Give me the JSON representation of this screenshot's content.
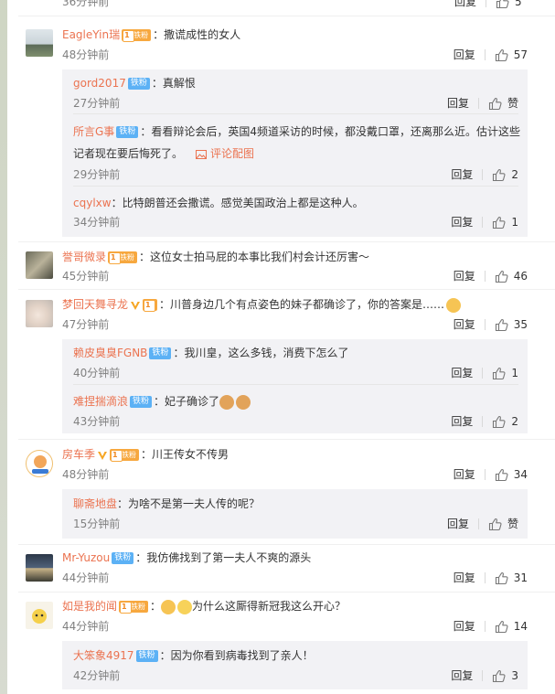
{
  "top_partial": {
    "reply": "回复",
    "likes": "5",
    "time": "36分钟前"
  },
  "labels": {
    "reply": "回复",
    "like_zan": "赞",
    "pic_comment": "评论配图"
  },
  "badges": {
    "tie": "铁粉",
    "fan": "铁粉",
    "fan_level": "1"
  },
  "colors": {
    "username": "#eb7350",
    "time": "#808080",
    "badge_blue": "#5cb1f5",
    "badge_orange": "#f7a83f",
    "reply_bg": "#f2f2f5"
  },
  "comments": [
    {
      "user": "EagleYin瑞",
      "text": "：撒谎成性的女人",
      "time": "48分钟前",
      "likes": "57"
    },
    {
      "user": "誉哥微录",
      "text": "：这位女士拍马屁的本事比我们村会计还厉害～",
      "time": "45分钟前",
      "likes": "46"
    },
    {
      "user": "梦回天舞寻龙",
      "text": "：川普身边几个有点姿色的妹子都确诊了，你的答案是……",
      "time": "47分钟前",
      "likes": "35"
    },
    {
      "user": "房车季",
      "text": "：川王传女不传男",
      "time": "48分钟前",
      "likes": "34"
    },
    {
      "user": "Mr-Yuzou",
      "text": "：我仿佛找到了第一夫人不爽的源头",
      "time": "44分钟前",
      "likes": "31"
    },
    {
      "user": "如是我的闻",
      "text": "为什么这厮得新冠我这么开心？",
      "time": "44分钟前",
      "likes": "14"
    }
  ],
  "replies": {
    "c1": [
      {
        "user": "gord2017",
        "text": "：真解恨",
        "time": "27分钟前",
        "likes": "赞"
      },
      {
        "user": "所言G事",
        "text": "：看看辩论会后，英国4频道采访的时候，都没戴口罩，还离那么近。估计这些",
        "text2": "记者现在要后悔死了。",
        "time": "29分钟前",
        "likes": "2"
      },
      {
        "user": "cqylxw",
        "text": "：比特朗普还会撒谎。感觉美国政治上都是这种人。",
        "time": "34分钟前",
        "likes": "1"
      }
    ],
    "c3": [
      {
        "user": "赖皮臭臭FGNB",
        "text": "：我川皇，这么多钱，消费下怎么了",
        "time": "40分钟前",
        "likes": "1"
      },
      {
        "user": "难捏揣滴浪",
        "text": "：妃子确诊了",
        "time": "43分钟前",
        "likes": "2"
      }
    ],
    "c4": [
      {
        "user": "聊斋地盘",
        "text": "：为啥不是第一夫人传的呢？",
        "time": "15分钟前",
        "likes": "赞"
      }
    ],
    "c6": [
      {
        "user": "大笨象4917",
        "text": "：因为你看到病毒找到了亲人！",
        "time": "42分钟前",
        "likes": "3"
      }
    ]
  }
}
